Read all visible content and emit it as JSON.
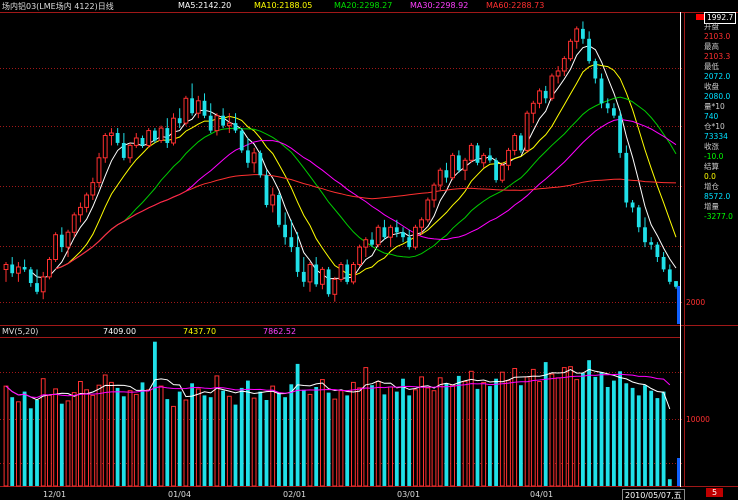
{
  "header": {
    "title": "场内铝03(LME场内 4122)日线",
    "ma5": "MA5:2142.20",
    "ma10": "MA10:2188.05",
    "ma20": "MA20:2298.27",
    "ma30": "MA30:2298.92",
    "ma60": "MA60:2288.73"
  },
  "volume_header": {
    "title": "MV(5,20)",
    "v1": "7409.00",
    "v2": "7437.70",
    "v3": "7862.52"
  },
  "right_axis": {
    "price_2000": "2000",
    "vol_10000": "10000"
  },
  "side_panel": [
    {
      "label": "1992.7",
      "color": "#ffffff",
      "box": true
    },
    {
      "label": "开盘",
      "color": "#cccccc"
    },
    {
      "label": "2103.0",
      "color": "#ff3030"
    },
    {
      "label": "最高",
      "color": "#cccccc"
    },
    {
      "label": "2103.3",
      "color": "#ff3030"
    },
    {
      "label": "最低",
      "color": "#cccccc"
    },
    {
      "label": "2072.0",
      "color": "#00e0ff"
    },
    {
      "label": "收盘",
      "color": "#cccccc"
    },
    {
      "label": "2080.0",
      "color": "#00e0ff"
    },
    {
      "label": "量*10",
      "color": "#cccccc"
    },
    {
      "label": "740",
      "color": "#00e0ff"
    },
    {
      "label": "仓*10",
      "color": "#cccccc"
    },
    {
      "label": "73334",
      "color": "#00e0ff"
    },
    {
      "label": "收涨",
      "color": "#cccccc"
    },
    {
      "label": "-10.0",
      "color": "#00ff00"
    },
    {
      "label": "结算",
      "color": "#cccccc"
    },
    {
      "label": "0.0",
      "color": "#ffff00"
    },
    {
      "label": "增仓",
      "color": "#cccccc"
    },
    {
      "label": "8572.0",
      "color": "#00e0ff"
    },
    {
      "label": "增量",
      "color": "#cccccc"
    },
    {
      "label": "-3277.0",
      "color": "#00ff00"
    }
  ],
  "x_axis": {
    "labels": [
      "12/01",
      "01/04",
      "02/01",
      "03/01",
      "04/01"
    ],
    "current_date": "2010/05/07,五",
    "corner": "5"
  },
  "colors": {
    "up": "#ff3030",
    "down": "#20e0e8",
    "ma5": "#ffffff",
    "ma10": "#ffff00",
    "ma20": "#00cc00",
    "ma30": "#ff00ff",
    "ma60": "#ff3030",
    "grid": "#a01818"
  },
  "chart_data": {
    "type": "candlestick",
    "price_axis_ticks": [
      2000
    ],
    "volume_axis_ticks": [
      10000
    ],
    "candles": [
      [
        2150,
        2180,
        2100,
        2170
      ],
      [
        2170,
        2200,
        2120,
        2135
      ],
      [
        2135,
        2180,
        2100,
        2160
      ],
      [
        2160,
        2190,
        2140,
        2150
      ],
      [
        2150,
        2160,
        2080,
        2095
      ],
      [
        2095,
        2150,
        2050,
        2060
      ],
      [
        2060,
        2140,
        2030,
        2120
      ],
      [
        2120,
        2200,
        2110,
        2190
      ],
      [
        2190,
        2300,
        2180,
        2290
      ],
      [
        2290,
        2320,
        2220,
        2240
      ],
      [
        2240,
        2310,
        2200,
        2300
      ],
      [
        2300,
        2380,
        2280,
        2370
      ],
      [
        2370,
        2420,
        2340,
        2400
      ],
      [
        2400,
        2460,
        2380,
        2450
      ],
      [
        2450,
        2520,
        2430,
        2500
      ],
      [
        2500,
        2620,
        2480,
        2600
      ],
      [
        2600,
        2700,
        2580,
        2690
      ],
      [
        2690,
        2720,
        2650,
        2700
      ],
      [
        2700,
        2720,
        2650,
        2660
      ],
      [
        2660,
        2700,
        2590,
        2600
      ],
      [
        2600,
        2660,
        2580,
        2650
      ],
      [
        2650,
        2700,
        2640,
        2680
      ],
      [
        2680,
        2690,
        2640,
        2650
      ],
      [
        2650,
        2720,
        2640,
        2710
      ],
      [
        2710,
        2720,
        2660,
        2670
      ],
      [
        2670,
        2730,
        2660,
        2720
      ],
      [
        2720,
        2760,
        2640,
        2660
      ],
      [
        2660,
        2780,
        2650,
        2760
      ],
      [
        2760,
        2800,
        2720,
        2740
      ],
      [
        2740,
        2850,
        2730,
        2840
      ],
      [
        2840,
        2900,
        2770,
        2780
      ],
      [
        2780,
        2850,
        2760,
        2830
      ],
      [
        2830,
        2860,
        2760,
        2770
      ],
      [
        2770,
        2820,
        2700,
        2710
      ],
      [
        2710,
        2780,
        2690,
        2770
      ],
      [
        2770,
        2800,
        2720,
        2730
      ],
      [
        2730,
        2780,
        2700,
        2740
      ],
      [
        2740,
        2780,
        2700,
        2710
      ],
      [
        2710,
        2720,
        2620,
        2630
      ],
      [
        2630,
        2680,
        2560,
        2580
      ],
      [
        2580,
        2640,
        2540,
        2620
      ],
      [
        2620,
        2630,
        2520,
        2530
      ],
      [
        2530,
        2550,
        2400,
        2410
      ],
      [
        2410,
        2480,
        2380,
        2450
      ],
      [
        2450,
        2460,
        2320,
        2330
      ],
      [
        2330,
        2380,
        2250,
        2280
      ],
      [
        2280,
        2350,
        2220,
        2240
      ],
      [
        2240,
        2300,
        2120,
        2140
      ],
      [
        2140,
        2200,
        2080,
        2100
      ],
      [
        2100,
        2180,
        2060,
        2170
      ],
      [
        2170,
        2200,
        2080,
        2090
      ],
      [
        2090,
        2160,
        2070,
        2150
      ],
      [
        2150,
        2160,
        2040,
        2050
      ],
      [
        2050,
        2120,
        2020,
        2110
      ],
      [
        2110,
        2180,
        2100,
        2170
      ],
      [
        2170,
        2190,
        2090,
        2100
      ],
      [
        2100,
        2180,
        2090,
        2170
      ],
      [
        2170,
        2250,
        2160,
        2240
      ],
      [
        2240,
        2280,
        2200,
        2270
      ],
      [
        2270,
        2300,
        2240,
        2250
      ],
      [
        2250,
        2330,
        2240,
        2320
      ],
      [
        2320,
        2350,
        2270,
        2280
      ],
      [
        2280,
        2330,
        2240,
        2320
      ],
      [
        2320,
        2350,
        2280,
        2300
      ],
      [
        2300,
        2320,
        2260,
        2280
      ],
      [
        2280,
        2310,
        2230,
        2240
      ],
      [
        2240,
        2330,
        2230,
        2320
      ],
      [
        2320,
        2360,
        2290,
        2350
      ],
      [
        2350,
        2440,
        2340,
        2430
      ],
      [
        2430,
        2500,
        2400,
        2490
      ],
      [
        2490,
        2560,
        2470,
        2550
      ],
      [
        2550,
        2580,
        2500,
        2520
      ],
      [
        2520,
        2620,
        2510,
        2610
      ],
      [
        2610,
        2630,
        2540,
        2550
      ],
      [
        2550,
        2600,
        2510,
        2590
      ],
      [
        2590,
        2660,
        2580,
        2650
      ],
      [
        2650,
        2660,
        2570,
        2580
      ],
      [
        2580,
        2620,
        2560,
        2610
      ],
      [
        2610,
        2640,
        2580,
        2590
      ],
      [
        2590,
        2600,
        2500,
        2510
      ],
      [
        2510,
        2580,
        2500,
        2570
      ],
      [
        2570,
        2640,
        2550,
        2630
      ],
      [
        2630,
        2700,
        2610,
        2690
      ],
      [
        2690,
        2700,
        2620,
        2630
      ],
      [
        2630,
        2790,
        2620,
        2780
      ],
      [
        2780,
        2830,
        2740,
        2820
      ],
      [
        2820,
        2880,
        2800,
        2870
      ],
      [
        2870,
        2890,
        2820,
        2840
      ],
      [
        2840,
        2940,
        2830,
        2930
      ],
      [
        2930,
        2970,
        2900,
        2950
      ],
      [
        2950,
        3010,
        2930,
        3000
      ],
      [
        3000,
        3080,
        2990,
        3070
      ],
      [
        3070,
        3130,
        3040,
        3120
      ],
      [
        3120,
        3150,
        3060,
        3080
      ],
      [
        3080,
        3110,
        2980,
        2990
      ],
      [
        2990,
        3000,
        2900,
        2920
      ],
      [
        2920,
        2940,
        2800,
        2820
      ],
      [
        2820,
        2840,
        2780,
        2800
      ],
      [
        2800,
        2820,
        2760,
        2770
      ],
      [
        2770,
        2790,
        2600,
        2620
      ],
      [
        2620,
        2650,
        2400,
        2420
      ],
      [
        2420,
        2430,
        2380,
        2400
      ],
      [
        2400,
        2410,
        2300,
        2320
      ],
      [
        2320,
        2360,
        2240,
        2260
      ],
      [
        2260,
        2280,
        2230,
        2250
      ],
      [
        2250,
        2260,
        2180,
        2200
      ],
      [
        2200,
        2220,
        2140,
        2150
      ],
      [
        2150,
        2170,
        2090,
        2100
      ],
      [
        2103.0,
        2103.3,
        2072.0,
        2080.0
      ]
    ],
    "volumes": [
      10800,
      9600,
      9100,
      10200,
      8400,
      9300,
      11600,
      9800,
      10500,
      8900,
      9200,
      10100,
      11300,
      10400,
      9800,
      10900,
      12000,
      11200,
      10600,
      9700,
      10300,
      9900,
      11200,
      10400,
      15600,
      10800,
      9400,
      8600,
      10200,
      9300,
      11100,
      10500,
      9800,
      9600,
      11900,
      10300,
      9700,
      8800,
      10600,
      11400,
      9500,
      10200,
      9300,
      10800,
      10100,
      9600,
      11000,
      13200,
      10400,
      9900,
      10700,
      11500,
      10100,
      9400,
      10300,
      9800,
      11200,
      10600,
      12800,
      10900,
      11300,
      9900,
      10700,
      10200,
      11600,
      9800,
      10400,
      11800,
      10600,
      10300,
      11700,
      11100,
      10900,
      11900,
      11300,
      12400,
      10500,
      11200,
      10800,
      11600,
      12300,
      11400,
      12700,
      10900,
      11800,
      12600,
      11300,
      13400,
      12100,
      11700,
      12800,
      12900,
      11500,
      12200,
      13600,
      11800,
      12300,
      10700,
      11400,
      12400,
      11100,
      10600,
      9800,
      10900,
      10300,
      9500,
      10200,
      740
    ]
  }
}
